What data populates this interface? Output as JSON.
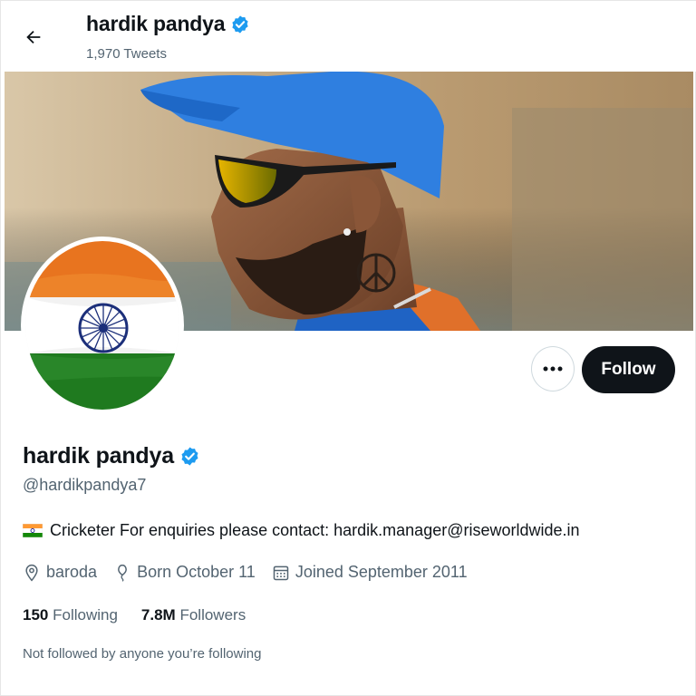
{
  "header": {
    "name": "hardik pandya",
    "tweets_count": "1,970 Tweets"
  },
  "actions": {
    "follow_label": "Follow",
    "more_label": "•••"
  },
  "profile": {
    "name": "hardik pandya",
    "handle": "@hardikpandya7",
    "bio": "Cricketer For enquiries please contact: hardik.manager@riseworldwide.in",
    "location": "baroda",
    "birthday": "Born October 11",
    "joined": "Joined September 2011",
    "following_count": "150",
    "following_label": "Following",
    "followers_count": "7.8M",
    "followers_label": "Followers",
    "followed_by_note": "Not followed by anyone you’re following"
  },
  "colors": {
    "verified": "#1d9bf0",
    "saffron": "#ff9933",
    "green": "#138808",
    "chakra": "#000080",
    "follow_bg": "#0f1419"
  },
  "icons": [
    "back-arrow-icon",
    "verified-badge-icon",
    "more-icon",
    "location-icon",
    "birthday-icon",
    "calendar-icon",
    "india-flag-icon"
  ]
}
